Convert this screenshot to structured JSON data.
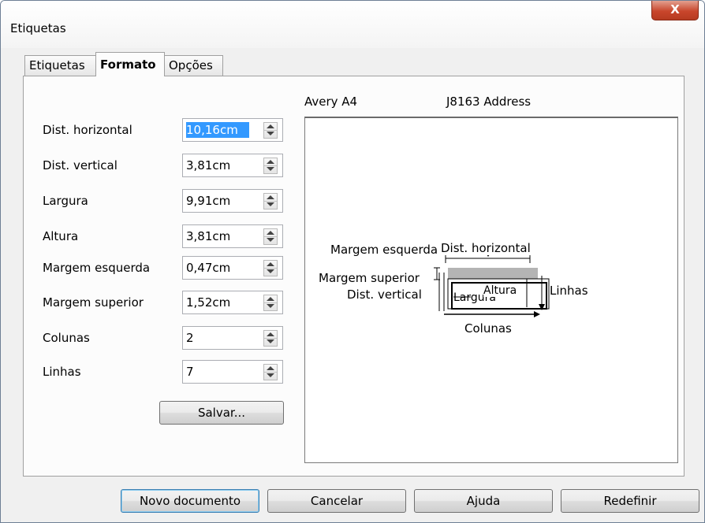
{
  "window": {
    "title": "Etiquetas",
    "close_label": "X"
  },
  "tabs": [
    {
      "label": "Etiquetas",
      "active": false
    },
    {
      "label": "Formato",
      "active": true
    },
    {
      "label": "Opções",
      "active": false
    }
  ],
  "fields": [
    {
      "label": "Dist. horizontal",
      "value": "10,16cm"
    },
    {
      "label": "Dist. vertical",
      "value": "3,81cm"
    },
    {
      "label": "Largura",
      "value": "9,91cm"
    },
    {
      "label": "Altura",
      "value": "3,81cm"
    },
    {
      "label": "Margem esquerda",
      "value": "0,47cm"
    },
    {
      "label": "Margem superior",
      "value": "1,52cm"
    },
    {
      "label": "Colunas",
      "value": "2"
    },
    {
      "label": "Linhas",
      "value": "7"
    }
  ],
  "save_button": "Salvar...",
  "preview": {
    "brand": "Avery A4",
    "product": "J8163 Address",
    "label_margem_esquerda": "Margem esquerda",
    "label_dist_horizontal": "Dist. horizontal",
    "label_margem_superior": "Margem superior",
    "label_dist_vertical": "Dist. vertical",
    "label_largura": "Largura",
    "label_altura": "Altura",
    "label_linhas": "Linhas",
    "label_colunas": "Colunas"
  },
  "buttons": {
    "novo_documento": "Novo documento",
    "cancelar": "Cancelar",
    "ajuda": "Ajuda",
    "redefinir": "Redefinir"
  },
  "colors": {
    "selection": "#3399ff",
    "close_button": "#c9462c",
    "default_button_border": "#3c7fb1"
  }
}
